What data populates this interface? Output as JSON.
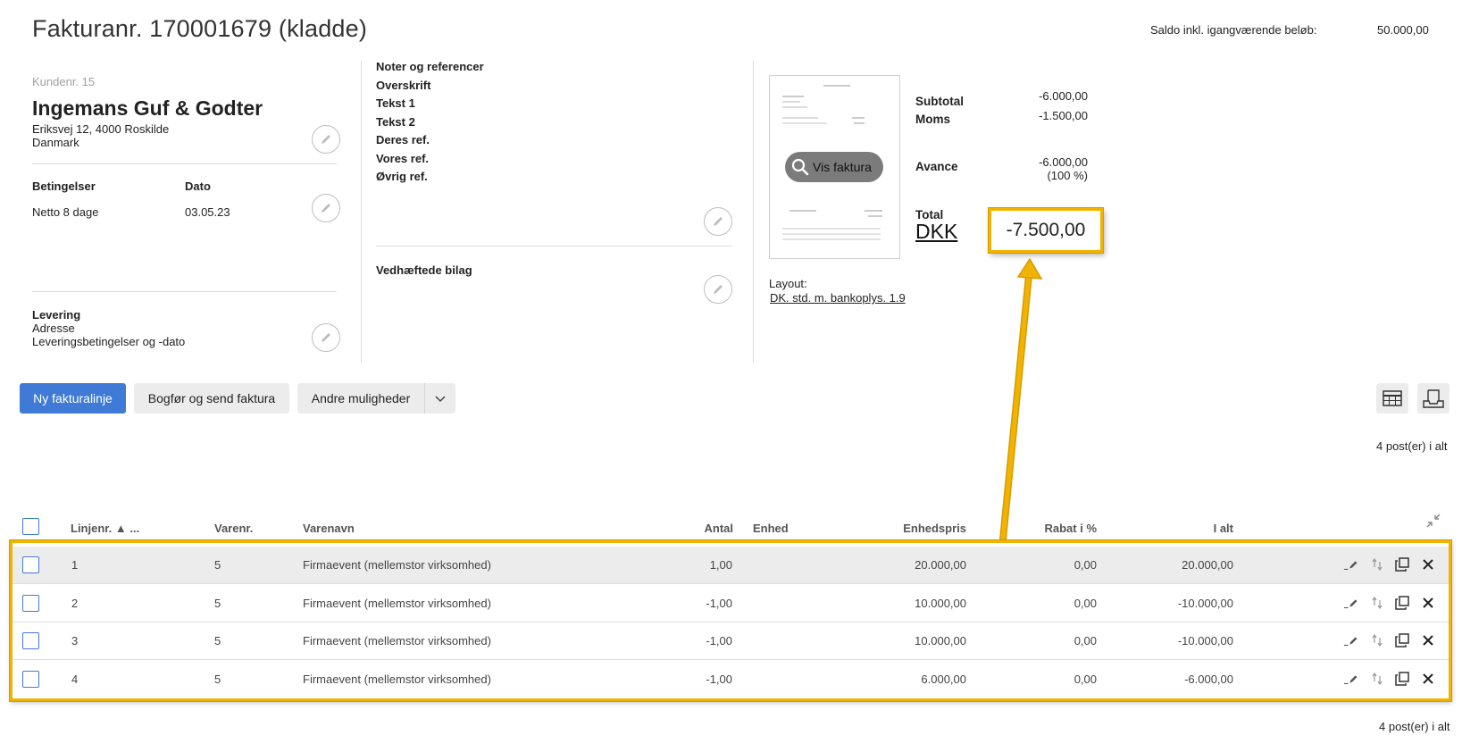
{
  "header": {
    "title": "Fakturanr. 170001679 (kladde)",
    "balance_label": "Saldo inkl. igangværende beløb:",
    "balance_value": "50.000,00"
  },
  "customer": {
    "number_label": "Kundenr. 15",
    "name": "Ingemans Guf & Godter",
    "address": "Eriksvej 12, 4000 Roskilde",
    "country": "Danmark",
    "terms_label": "Betingelser",
    "terms_value": "Netto 8 dage",
    "date_label": "Dato",
    "date_value": "03.05.23",
    "delivery_label": "Levering",
    "delivery_address": "Adresse",
    "delivery_terms": "Leveringsbetingelser og -dato"
  },
  "notes": {
    "items": [
      "Noter og referencer",
      "Overskrift",
      "Tekst 1",
      "Tekst 2",
      "Deres ref.",
      "Vores ref.",
      "Øvrig ref."
    ],
    "attachments_label": "Vedhæftede bilag"
  },
  "preview": {
    "button_label": "Vis faktura",
    "layout_label": "Layout:",
    "layout_value": "DK. std. m. bankoplys. 1.9"
  },
  "summary": {
    "subtotal_label": "Subtotal",
    "subtotal_value": "-6.000,00",
    "vat_label": "Moms",
    "vat_value": "-1.500,00",
    "margin_label": "Avance",
    "margin_value": "-6.000,00",
    "margin_pct": "(100 %)",
    "total_label": "Total",
    "currency": "DKK",
    "total_value": "-7.500,00"
  },
  "toolbar": {
    "new_line": "Ny fakturalinje",
    "post_send": "Bogfør og send faktura",
    "other_options": "Andre muligheder"
  },
  "table": {
    "count_top": "4 post(er) i alt",
    "count_bottom": "4 post(er) i alt",
    "columns": {
      "line": "Linjenr. ▲ ...",
      "item_no": "Varenr.",
      "item_name": "Varenavn",
      "qty": "Antal",
      "unit": "Enhed",
      "unit_price": "Enhedspris",
      "discount": "Rabat i %",
      "total": "I alt"
    },
    "rows": [
      {
        "line": "1",
        "item_no": "5",
        "item_name": "Firmaevent (mellemstor virksomhed)",
        "qty": "1,00",
        "unit": "",
        "unit_price": "20.000,00",
        "discount": "0,00",
        "total": "20.000,00"
      },
      {
        "line": "2",
        "item_no": "5",
        "item_name": "Firmaevent (mellemstor virksomhed)",
        "qty": "-1,00",
        "unit": "",
        "unit_price": "10.000,00",
        "discount": "0,00",
        "total": "-10.000,00"
      },
      {
        "line": "3",
        "item_no": "5",
        "item_name": "Firmaevent (mellemstor virksomhed)",
        "qty": "-1,00",
        "unit": "",
        "unit_price": "10.000,00",
        "discount": "0,00",
        "total": "-10.000,00"
      },
      {
        "line": "4",
        "item_no": "5",
        "item_name": "Firmaevent (mellemstor virksomhed)",
        "qty": "-1,00",
        "unit": "",
        "unit_price": "6.000,00",
        "discount": "0,00",
        "total": "-6.000,00"
      }
    ]
  },
  "colors": {
    "primary": "#3f7bd6",
    "highlight": "#f0b400",
    "row_selected": "#ececec"
  }
}
